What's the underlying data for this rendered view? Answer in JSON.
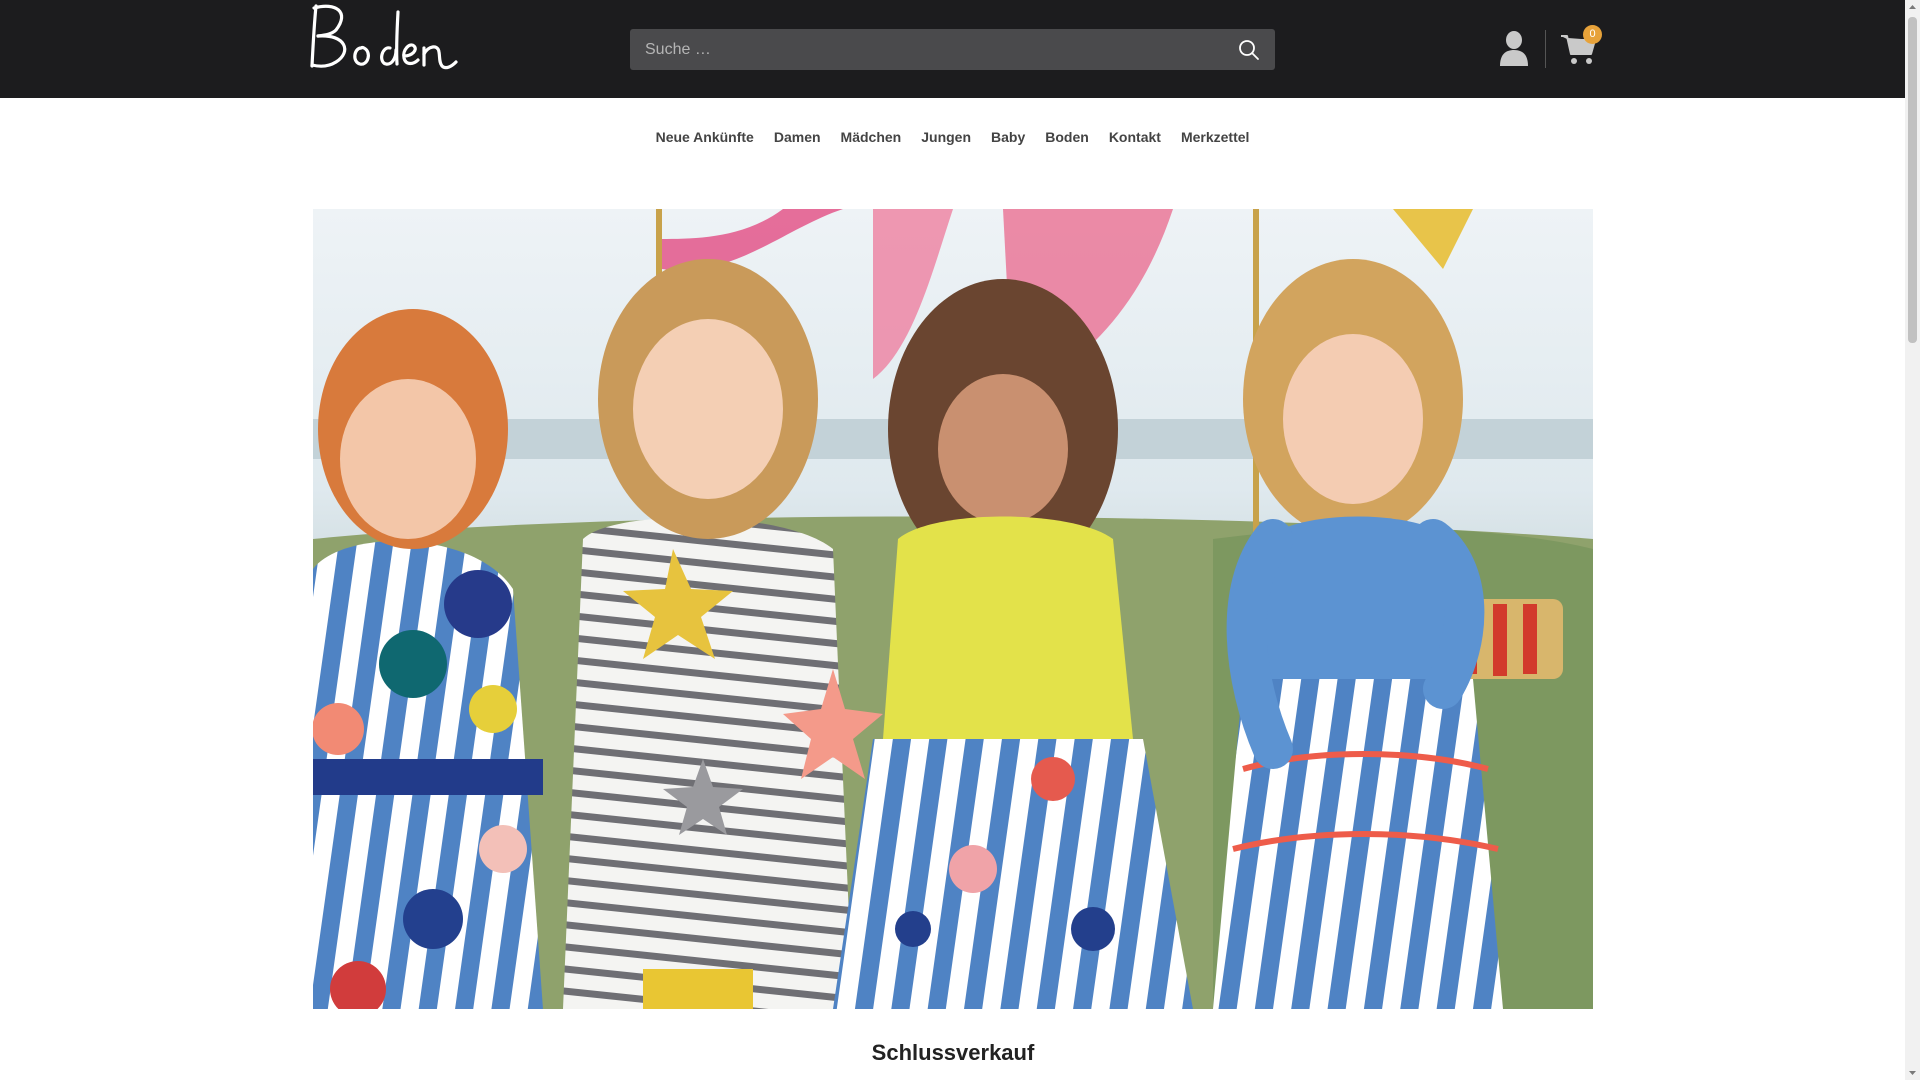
{
  "header": {
    "logo_text": "Boden",
    "search": {
      "placeholder": "Suche …",
      "value": ""
    },
    "cart_count": "0",
    "icons": {
      "search": "search-icon",
      "user": "user-icon",
      "cart": "cart-icon"
    },
    "colors": {
      "topbar": "#1c1c1e",
      "badge": "#e7a23a"
    }
  },
  "nav": {
    "items": [
      {
        "label": "Neue Ankünfte"
      },
      {
        "label": "Damen"
      },
      {
        "label": "Mädchen"
      },
      {
        "label": "Jungen"
      },
      {
        "label": "Baby"
      },
      {
        "label": "Boden"
      },
      {
        "label": "Kontakt"
      },
      {
        "label": "Merkzettel"
      }
    ]
  },
  "main": {
    "section_title": "Schlussverkauf"
  }
}
